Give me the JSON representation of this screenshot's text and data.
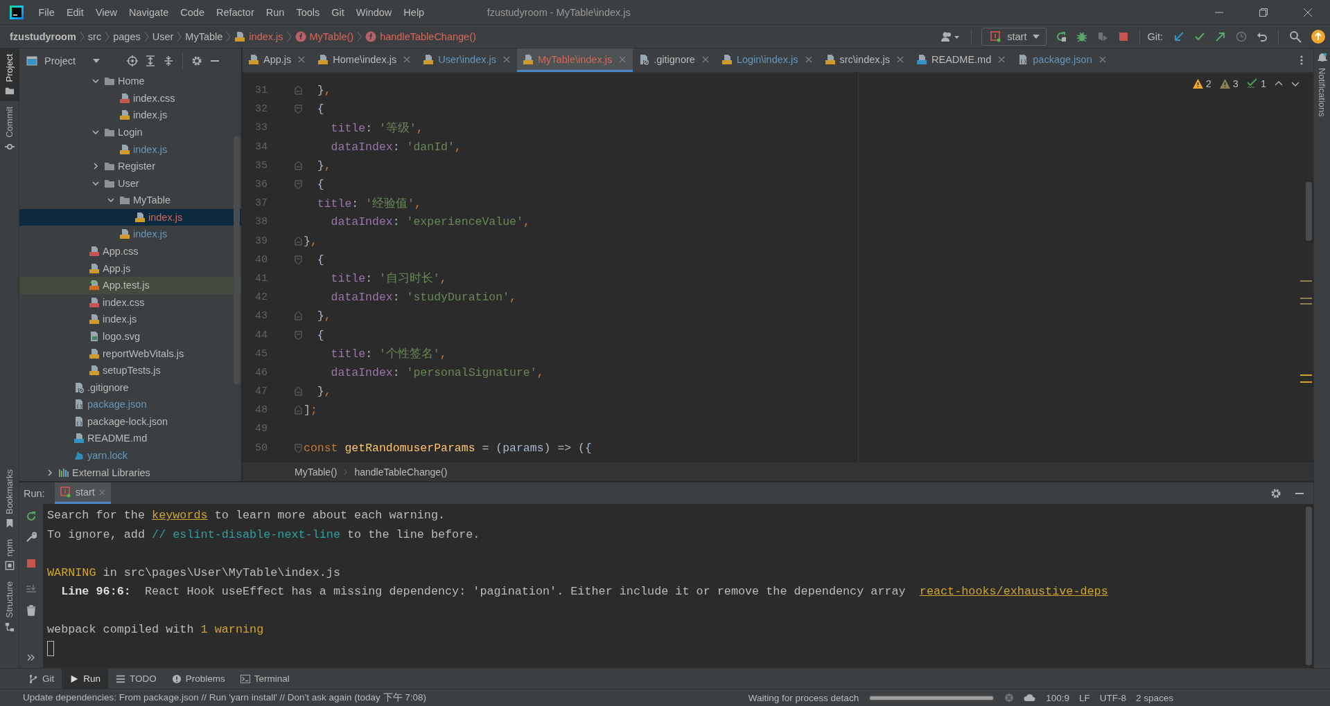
{
  "window": {
    "title": "fzustudyroom - MyTable\\index.js"
  },
  "menu": [
    "File",
    "Edit",
    "View",
    "Navigate",
    "Code",
    "Refactor",
    "Run",
    "Tools",
    "Git",
    "Window",
    "Help"
  ],
  "navbar": {
    "crumbs": [
      {
        "kind": "project",
        "text": "fzustudyroom"
      },
      {
        "kind": "folder",
        "text": "src"
      },
      {
        "kind": "folder",
        "text": "pages"
      },
      {
        "kind": "folder",
        "text": "User"
      },
      {
        "kind": "folder",
        "text": "MyTable"
      },
      {
        "kind": "file",
        "text": "index.js"
      },
      {
        "kind": "function",
        "text": "MyTable()"
      },
      {
        "kind": "function",
        "text": "handleTableChange()"
      }
    ],
    "toolbar": [
      {
        "kind": "user",
        "disabled": false
      },
      {
        "kind": "run_config",
        "label": "start",
        "disabled": false
      },
      {
        "kind": "rerun",
        "disabled": false
      },
      {
        "kind": "debug",
        "disabled": false
      },
      {
        "kind": "coverage",
        "disabled": true
      },
      {
        "kind": "stop",
        "disabled": false
      },
      {
        "kind": "git_label",
        "label": "Git:",
        "disabled": false
      },
      {
        "kind": "update",
        "disabled": false
      },
      {
        "kind": "commit",
        "disabled": false
      },
      {
        "kind": "push",
        "disabled": false
      },
      {
        "kind": "history",
        "disabled": true
      },
      {
        "kind": "rollback",
        "disabled": false
      },
      {
        "kind": "search",
        "disabled": false
      },
      {
        "kind": "updates",
        "disabled": false
      }
    ]
  },
  "left_stripe": {
    "top": [
      {
        "kind": "project",
        "label": "Project",
        "selected": true
      },
      {
        "kind": "commit",
        "label": "Commit",
        "selected": false
      }
    ],
    "bottom": [
      {
        "kind": "bookmarks",
        "label": "Bookmarks"
      },
      {
        "kind": "npm",
        "label": "npm"
      },
      {
        "kind": "structure",
        "label": "Structure"
      }
    ]
  },
  "right_stripe": {
    "label": "Notifications"
  },
  "project_panel": {
    "title": "Project",
    "tree": {
      "inner": {
        "inner": {
          "inner": {
            "items": [
              {
                "label": "Home",
                "kind": "folder",
                "color": "#bbbbbb",
                "selected": false,
                "expanded": true,
                "children": [
                  {
                    "label": "index.css",
                    "kind": "css",
                    "color": "#bbbbbb",
                    "selected": false
                  },
                  {
                    "label": "index.js",
                    "kind": "js",
                    "color": "#bbbbbb",
                    "selected": false
                  }
                ]
              },
              {
                "label": "Login",
                "kind": "folder",
                "color": "#bbbbbb",
                "selected": false,
                "expanded": true,
                "children": [
                  {
                    "label": "index.js",
                    "kind": "js",
                    "color": "#6897bb",
                    "selected": false
                  }
                ]
              },
              {
                "label": "Register",
                "kind": "folder",
                "color": "#bbbbbb",
                "selected": false,
                "expanded": false
              },
              {
                "label": "User",
                "kind": "folder",
                "color": "#bbbbbb",
                "selected": false,
                "expanded": true,
                "children": [
                  {
                    "label": "MyTable",
                    "kind": "folder",
                    "color": "#bbbbbb",
                    "selected": false,
                    "expanded": true,
                    "children": [
                      {
                        "label": "index.js",
                        "kind": "js",
                        "color": "#d6675a",
                        "selected": true
                      }
                    ]
                  },
                  {
                    "label": "index.js",
                    "kind": "js",
                    "color": "#6897bb",
                    "selected": false
                  }
                ]
              }
            ]
          },
          "items": [
            {
              "label": "App.css",
              "kind": "css",
              "color": "#bbbbbb",
              "selected": false
            },
            {
              "label": "App.js",
              "kind": "js",
              "color": "#bbbbbb",
              "selected": false
            },
            {
              "label": "App.test.js",
              "kind": "jstest",
              "color": "#bbbbbb",
              "selected": false
            },
            {
              "label": "index.css",
              "kind": "css",
              "color": "#bbbbbb",
              "selected": false
            },
            {
              "label": "index.js",
              "kind": "js",
              "color": "#bbbbbb",
              "selected": false
            },
            {
              "label": "logo.svg",
              "kind": "svg",
              "color": "#bbbbbb",
              "selected": false
            },
            {
              "label": "reportWebVitals.js",
              "kind": "js",
              "color": "#bbbbbb",
              "selected": false
            },
            {
              "label": "setupTests.js",
              "kind": "js",
              "color": "#bbbbbb",
              "selected": false
            }
          ]
        },
        "items": [
          {
            "label": ".gitignore",
            "kind": "gitignore",
            "color": "#bbbbbb",
            "selected": false
          },
          {
            "label": "package.json",
            "kind": "json",
            "color": "#6897bb",
            "selected": false
          },
          {
            "label": "package-lock.json",
            "kind": "json",
            "color": "#bbbbbb",
            "selected": false
          },
          {
            "label": "README.md",
            "kind": "md",
            "color": "#bbbbbb",
            "selected": false
          },
          {
            "label": "yarn.lock",
            "kind": "yarn",
            "color": "#6897bb",
            "selected": false
          }
        ]
      },
      "items": [
        {
          "label": "External Libraries",
          "kind": "libs",
          "color": "#bbbbbb",
          "selected": false,
          "expanded": false
        }
      ]
    }
  },
  "tabs": [
    {
      "label": "App.js",
      "kind": "js",
      "color": "#bbbbbb",
      "selected": false
    },
    {
      "label": "Home\\index.js",
      "kind": "js",
      "color": "#bbbbbb",
      "selected": false
    },
    {
      "label": "User\\index.js",
      "kind": "js",
      "color": "#6897bb",
      "selected": false
    },
    {
      "label": "MyTable\\index.js",
      "kind": "js",
      "color": "#d6675a",
      "selected": true
    },
    {
      "label": ".gitignore",
      "kind": "gitignore",
      "color": "#bbbbbb",
      "selected": false
    },
    {
      "label": "Login\\index.js",
      "kind": "js",
      "color": "#6897bb",
      "selected": false
    },
    {
      "label": "src\\index.js",
      "kind": "js",
      "color": "#bbbbbb",
      "selected": false
    },
    {
      "label": "README.md",
      "kind": "md",
      "color": "#bbbbbb",
      "selected": false
    },
    {
      "label": "package.json",
      "kind": "json",
      "color": "#6897bb",
      "selected": false
    }
  ],
  "editor": {
    "inspections": [
      {
        "kind": "warning",
        "count": "2"
      },
      {
        "kind": "weak_warning",
        "count": "3"
      },
      {
        "kind": "typo",
        "count": "1"
      }
    ],
    "lines": [
      {
        "number": "31",
        "kind": "fold_end",
        "tokens": [
          {
            "kind": "plain",
            "text": "  }"
          },
          {
            "kind": "punc",
            "text": ","
          }
        ]
      },
      {
        "number": "32",
        "kind": "fold_start",
        "tokens": [
          {
            "kind": "plain",
            "text": "  {"
          }
        ]
      },
      {
        "number": "33",
        "kind": "plain",
        "tokens": [
          {
            "kind": "key",
            "text": "    title"
          },
          {
            "kind": "plain",
            "text": ": "
          },
          {
            "kind": "str",
            "text": "'等级'"
          },
          {
            "kind": "punc",
            "text": ","
          }
        ]
      },
      {
        "number": "34",
        "kind": "plain",
        "tokens": [
          {
            "kind": "key",
            "text": "    dataIndex"
          },
          {
            "kind": "plain",
            "text": ": "
          },
          {
            "kind": "str",
            "text": "'danId'"
          },
          {
            "kind": "punc",
            "text": ","
          }
        ]
      },
      {
        "number": "35",
        "kind": "fold_end",
        "tokens": [
          {
            "kind": "plain",
            "text": "  }"
          },
          {
            "kind": "punc",
            "text": ","
          }
        ]
      },
      {
        "number": "36",
        "kind": "fold_start",
        "tokens": [
          {
            "kind": "plain",
            "text": "  {"
          }
        ]
      },
      {
        "number": "37",
        "kind": "plain",
        "tokens": [
          {
            "kind": "key",
            "text": "  title"
          },
          {
            "kind": "plain",
            "text": ": "
          },
          {
            "kind": "str",
            "text": "'经验值'"
          },
          {
            "kind": "punc",
            "text": ","
          }
        ]
      },
      {
        "number": "38",
        "kind": "plain",
        "tokens": [
          {
            "kind": "key",
            "text": "    dataIndex"
          },
          {
            "kind": "plain",
            "text": ": "
          },
          {
            "kind": "str",
            "text": "'experienceValue'"
          },
          {
            "kind": "punc",
            "text": ","
          }
        ]
      },
      {
        "number": "39",
        "kind": "fold_end",
        "tokens": [
          {
            "kind": "plain",
            "text": "}"
          },
          {
            "kind": "punc",
            "text": ","
          }
        ]
      },
      {
        "number": "40",
        "kind": "fold_start",
        "tokens": [
          {
            "kind": "plain",
            "text": "  {"
          }
        ]
      },
      {
        "number": "41",
        "kind": "plain",
        "tokens": [
          {
            "kind": "key",
            "text": "    title"
          },
          {
            "kind": "plain",
            "text": ": "
          },
          {
            "kind": "str",
            "text": "'自习时长'"
          },
          {
            "kind": "punc",
            "text": ","
          }
        ]
      },
      {
        "number": "42",
        "kind": "plain",
        "tokens": [
          {
            "kind": "key",
            "text": "    dataIndex"
          },
          {
            "kind": "plain",
            "text": ": "
          },
          {
            "kind": "str",
            "text": "'studyDuration'"
          },
          {
            "kind": "punc",
            "text": ","
          }
        ]
      },
      {
        "number": "43",
        "kind": "fold_end",
        "tokens": [
          {
            "kind": "plain",
            "text": "  }"
          },
          {
            "kind": "punc",
            "text": ","
          }
        ]
      },
      {
        "number": "44",
        "kind": "fold_start",
        "tokens": [
          {
            "kind": "plain",
            "text": "  {"
          }
        ]
      },
      {
        "number": "45",
        "kind": "plain",
        "tokens": [
          {
            "kind": "key",
            "text": "    title"
          },
          {
            "kind": "plain",
            "text": ": "
          },
          {
            "kind": "str",
            "text": "'个性签名'"
          },
          {
            "kind": "punc",
            "text": ","
          }
        ]
      },
      {
        "number": "46",
        "kind": "plain",
        "tokens": [
          {
            "kind": "key",
            "text": "    dataIndex"
          },
          {
            "kind": "plain",
            "text": ": "
          },
          {
            "kind": "str",
            "text": "'personalSignature'"
          },
          {
            "kind": "punc",
            "text": ","
          }
        ]
      },
      {
        "number": "47",
        "kind": "fold_end",
        "tokens": [
          {
            "kind": "plain",
            "text": "  }"
          },
          {
            "kind": "punc",
            "text": ","
          }
        ]
      },
      {
        "number": "48",
        "kind": "fold_end",
        "tokens": [
          {
            "kind": "plain",
            "text": "]"
          },
          {
            "kind": "punc",
            "text": ";"
          }
        ]
      },
      {
        "number": "49",
        "kind": "plain"
      },
      {
        "number": "50",
        "kind": "fold_start",
        "tokens": [
          {
            "kind": "kw",
            "text": "const "
          },
          {
            "kind": "fn",
            "text": "getRandomuserParams"
          },
          {
            "kind": "plain",
            "text": " = (params) => ({"
          }
        ]
      }
    ],
    "breadcrumbs": [
      "MyTable()",
      "handleTableChange()"
    ]
  },
  "run_panel": {
    "label": "Run:",
    "tab": {
      "label": "start",
      "selected": true
    },
    "console": [
      {
        "kind": "text",
        "tokens": [
          {
            "kind": "plain",
            "text": "Search for the "
          },
          {
            "kind": "link",
            "text": "keywords"
          },
          {
            "kind": "plain",
            "text": " to learn more about each warning."
          }
        ]
      },
      {
        "kind": "text",
        "tokens": [
          {
            "kind": "plain",
            "text": "To ignore, add "
          },
          {
            "kind": "hint",
            "text": "// eslint-disable-next-line"
          },
          {
            "kind": "plain",
            "text": " to the line before."
          }
        ]
      },
      {
        "kind": "blank"
      },
      {
        "kind": "text",
        "tokens": [
          {
            "kind": "warn",
            "text": "WARNING"
          },
          {
            "kind": "plain",
            "text": " in src\\pages\\User\\MyTable\\index.js"
          }
        ]
      },
      {
        "kind": "text",
        "tokens": [
          {
            "kind": "bold",
            "text": "  Line 96:6:"
          },
          {
            "kind": "plain",
            "text": "  React Hook useEffect has a missing dependency: 'pagination'. Either include it or remove the dependency array  "
          },
          {
            "kind": "link",
            "text": "react-hooks/exhaustive-deps"
          }
        ]
      },
      {
        "kind": "blank"
      },
      {
        "kind": "text",
        "tokens": [
          {
            "kind": "plain",
            "text": "webpack compiled with "
          },
          {
            "kind": "warn",
            "text": "1 warning"
          }
        ]
      },
      {
        "kind": "prompt"
      }
    ]
  },
  "bottom_tools": [
    {
      "kind": "git",
      "label": "Git",
      "selected": false
    },
    {
      "kind": "run",
      "label": "Run",
      "selected": true
    },
    {
      "kind": "todo",
      "label": "TODO",
      "selected": false
    },
    {
      "kind": "problems",
      "label": "Problems",
      "selected": false
    },
    {
      "kind": "terminal",
      "label": "Terminal",
      "selected": false
    }
  ],
  "status_bar": {
    "message": "Update dependencies: From package.json // Run 'yarn install' // Don't ask again (today 下午 7:08)",
    "process": "Waiting for process detach",
    "progress": {
      "level": 1
    },
    "items": [
      "100:9",
      "LF",
      "UTF-8",
      "2 spaces"
    ]
  }
}
